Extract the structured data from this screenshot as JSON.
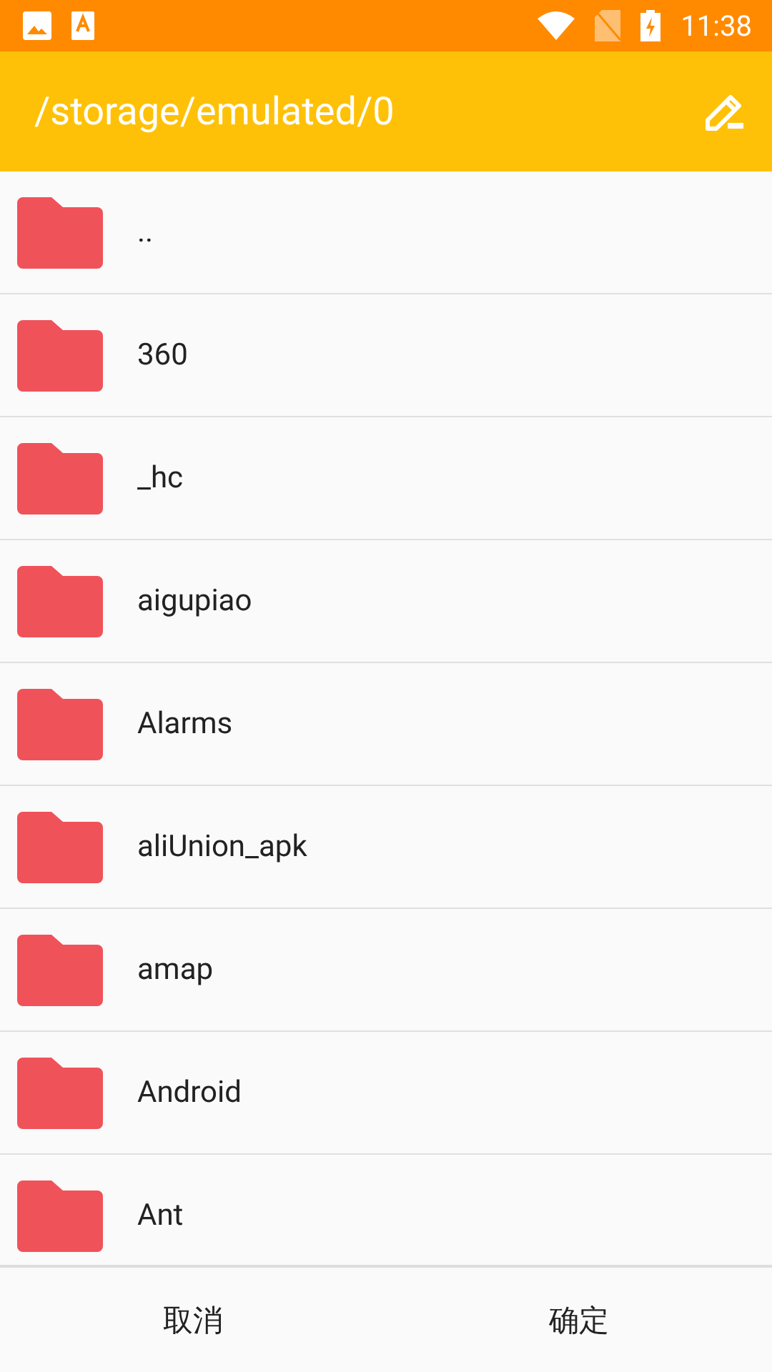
{
  "status_bar": {
    "time": "11:38"
  },
  "toolbar": {
    "title": "/storage/emulated/0"
  },
  "folders": [
    {
      "name": ".."
    },
    {
      "name": "360"
    },
    {
      "name": "_hc"
    },
    {
      "name": "aigupiao"
    },
    {
      "name": "Alarms"
    },
    {
      "name": "aliUnion_apk"
    },
    {
      "name": "amap"
    },
    {
      "name": "Android"
    },
    {
      "name": "Ant"
    }
  ],
  "buttons": [
    "取消",
    "确定"
  ]
}
